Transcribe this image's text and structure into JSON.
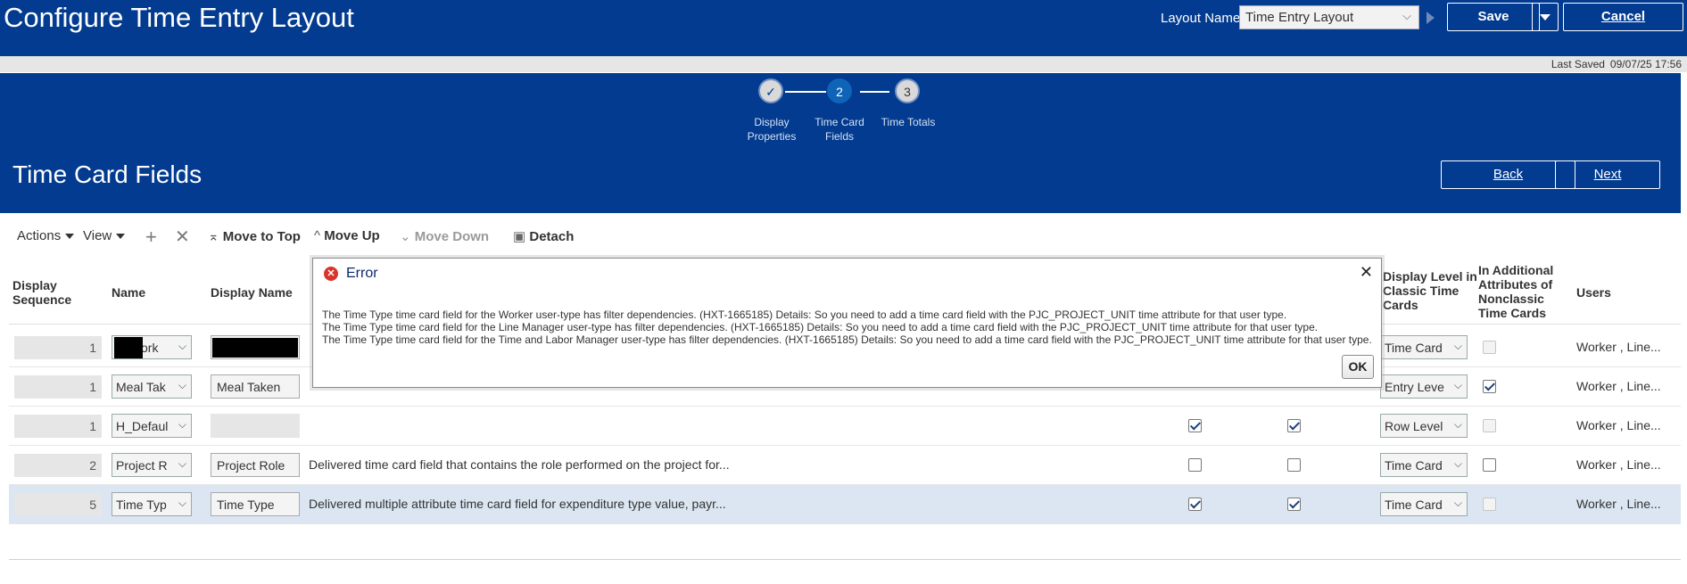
{
  "header": {
    "title": "Configure Time Entry Layout",
    "layout_name_label": "Layout Name",
    "layout_name_value": "Time Entry Layout",
    "save_label": "Save",
    "cancel_label": "Cancel",
    "last_saved_label": "Last Saved",
    "last_saved_value": "09/07/25 17:56"
  },
  "train": {
    "steps": [
      {
        "number": "✓",
        "label": "Display Properties",
        "state": "completed"
      },
      {
        "number": "2",
        "label": "Time Card Fields",
        "state": "current"
      },
      {
        "number": "3",
        "label": "Time Totals",
        "state": "pending"
      }
    ]
  },
  "section": {
    "title": "Time Card Fields",
    "back_label": "Back",
    "next_label": "Next"
  },
  "toolbar": {
    "actions_label": "Actions",
    "view_label": "View",
    "add_icon": "plus-icon",
    "delete_icon": "x-icon",
    "move_top_label": "Move to Top",
    "move_up_label": "Move Up",
    "move_down_label": "Move Down",
    "detach_label": "Detach"
  },
  "table": {
    "headers": {
      "display_sequence": "Display Sequence",
      "name": "Name",
      "display_name": "Display Name",
      "display_level": "Display Level in Classic Time Cards",
      "in_additional": "In Additional Attributes of Nonclassic Time Cards",
      "users": "Users"
    },
    "rows": [
      {
        "seq": "1",
        "name": "ork ",
        "display_name": "",
        "description": "",
        "cb1": null,
        "cb2": null,
        "level": "Time Card",
        "additional": "disabled",
        "users": "Worker , Line..."
      },
      {
        "seq": "1",
        "name": "Meal Tak",
        "display_name": "Meal Taken",
        "description": "",
        "cb1": null,
        "cb2": null,
        "level": "Entry Leve",
        "additional": "checked",
        "users": "Worker , Line..."
      },
      {
        "seq": "1",
        "name": "H_Defaul",
        "display_name": "",
        "description": "",
        "cb1": "checked",
        "cb2": "checked",
        "level": "Row Level",
        "additional": "disabled",
        "users": "Worker , Line..."
      },
      {
        "seq": "2",
        "name": "Project R",
        "display_name": "Project Role",
        "description": "Delivered time card field that contains the role performed on the project for...",
        "cb1": "unchecked",
        "cb2": "unchecked",
        "level": "Time Card",
        "additional": "unchecked",
        "users": "Worker , Line..."
      },
      {
        "seq": "5",
        "name": "Time Typ",
        "display_name": "Time Type",
        "description": "Delivered multiple attribute time card field for expenditure type value, payr...",
        "cb1": "checked",
        "cb2": "checked",
        "level": "Time Card",
        "additional": "disabled",
        "users": "Worker , Line..."
      }
    ]
  },
  "dialog": {
    "title": "Error",
    "icon": "error-icon",
    "messages": [
      "The Time Type time card field for the Worker user-type has filter dependencies. (HXT-1665185) Details: So you need to add a time card field with the PJC_PROJECT_UNIT time attribute for that user type.",
      "The Time Type time card field for the Line Manager user-type has filter dependencies. (HXT-1665185) Details: So you need to add a time card field with the PJC_PROJECT_UNIT time attribute for that user type.",
      "The Time Type time card field for the Time and Labor Manager user-type has filter dependencies. (HXT-1665185) Details: So you need to add a time card field with the PJC_PROJECT_UNIT time attribute for that user type."
    ],
    "ok_label": "OK",
    "close_icon": "close-icon"
  }
}
